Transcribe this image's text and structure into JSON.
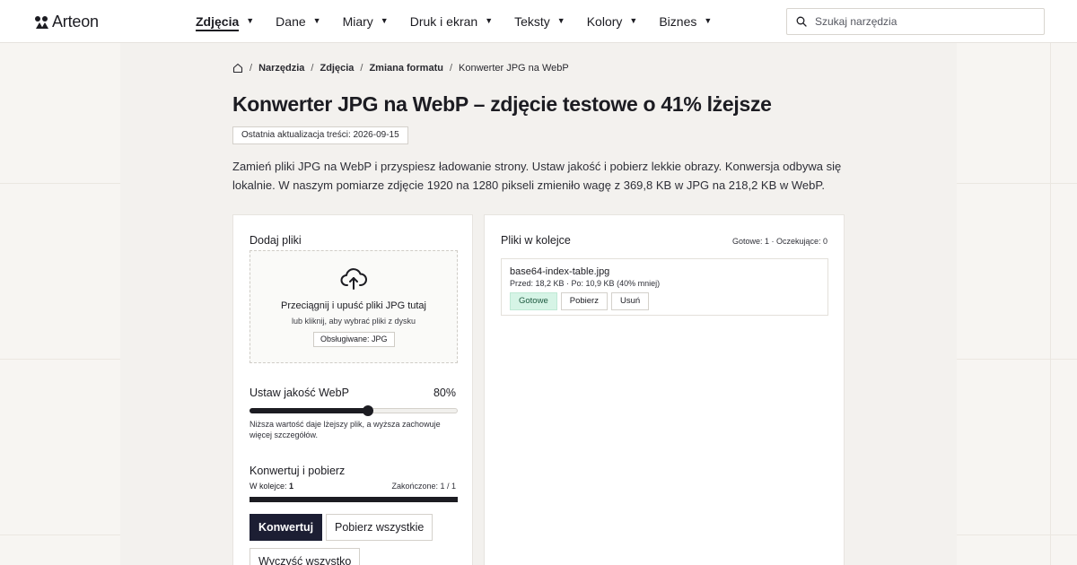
{
  "brand": {
    "name": "Arteon",
    "logo_icon": "arteon-logo-icon"
  },
  "nav": {
    "items": [
      {
        "label": "Zdjęcia",
        "active": true
      },
      {
        "label": "Dane",
        "active": false
      },
      {
        "label": "Miary",
        "active": false
      },
      {
        "label": "Druk i ekran",
        "active": false
      },
      {
        "label": "Teksty",
        "active": false
      },
      {
        "label": "Kolory",
        "active": false
      },
      {
        "label": "Biznes",
        "active": false
      }
    ],
    "caret": "▼"
  },
  "search": {
    "placeholder": "Szukaj narzędzia",
    "value": "",
    "icon": "search-icon"
  },
  "breadcrumb": {
    "home_icon": "home-icon",
    "separator": "/",
    "items": [
      "Narzędzia",
      "Zdjęcia",
      "Zmiana formatu"
    ],
    "current": "Konwerter JPG na WebP"
  },
  "page": {
    "title": "Konwerter JPG na WebP – zdjęcie testowe o 41% lżejsze",
    "updated": "Ostatnia aktualizacja treści: 2026-09-15",
    "intro": "Zamień pliki JPG na WebP i przyspiesz ładowanie strony. Ustaw jakość i pobierz lekkie obrazy. Konwersja odbywa się lokalnie. W naszym pomiarze zdjęcie 1920 na 1280 pikseli zmieniło wagę z 369,8 KB w JPG na 218,2 KB w WebP."
  },
  "upload": {
    "title": "Dodaj pliki",
    "icon": "cloud-upload-icon",
    "main": "Przeciągnij i upuść pliki JPG tutaj",
    "sub": "lub kliknij, aby wybrać pliki z dysku",
    "badge": "Obsługiwane: JPG"
  },
  "quality": {
    "label": "Ustaw jakość WebP",
    "value_text": "80%",
    "value": 80,
    "slider_fill": 0.57,
    "help": "Niższa wartość daje lżejszy plik, a wyższa zachowuje więcej szczegółów."
  },
  "convert": {
    "title": "Konwertuj i pobierz",
    "queue_label": "W kolejce:",
    "queue_count": "1",
    "done": "Zakończone: 1 / 1",
    "progress": 1.0,
    "convert_btn": "Konwertuj",
    "download_all_btn": "Pobierz wszystkie",
    "clear_btn": "Wyczyść wszystko"
  },
  "queue": {
    "title": "Pliki w kolejce",
    "stats": "Gotowe: 1 · Oczekujące: 0",
    "files": [
      {
        "name": "base64-index-table.jpg",
        "meta": "Przed: 18,2 KB · Po: 10,9 KB (40% mniej)",
        "status": "Gotowe",
        "download": "Pobierz",
        "remove": "Usuń"
      }
    ]
  },
  "colors": {
    "accent_dark": "#1c1e33",
    "status_ok_bg": "#d6f4e6",
    "status_ok_text": "#1e5a40"
  }
}
